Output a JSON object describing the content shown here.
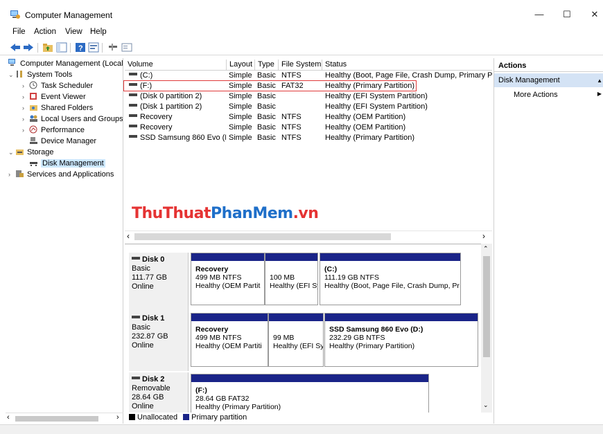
{
  "window": {
    "title": "Computer Management",
    "minimize_glyph": "—",
    "maximize_glyph": "☐",
    "close_glyph": "✕"
  },
  "menu": [
    "File",
    "Action",
    "View",
    "Help"
  ],
  "toolbar": {
    "icons": [
      "back-arrow-icon",
      "forward-arrow-icon",
      "up-folder-icon",
      "show-hide-tree-icon",
      "help-icon",
      "properties-icon",
      "connect-icon",
      "view-icon"
    ]
  },
  "tree": {
    "root": "Computer Management (Local",
    "system_tools": "System Tools",
    "task_scheduler": "Task Scheduler",
    "event_viewer": "Event Viewer",
    "shared_folders": "Shared Folders",
    "local_users": "Local Users and Groups",
    "performance": "Performance",
    "device_manager": "Device Manager",
    "storage": "Storage",
    "disk_management": "Disk Management",
    "services": "Services and Applications"
  },
  "volumes": {
    "headers": [
      "Volume",
      "Layout",
      "Type",
      "File System",
      "Status"
    ],
    "rows": [
      [
        "(C:)",
        "Simple",
        "Basic",
        "NTFS",
        "Healthy (Boot, Page File, Crash Dump, Primary Part"
      ],
      [
        "(F:)",
        "Simple",
        "Basic",
        "FAT32",
        "Healthy (Primary Partition)"
      ],
      [
        "(Disk 0 partition 2)",
        "Simple",
        "Basic",
        "",
        "Healthy (EFI System Partition)"
      ],
      [
        "(Disk 1 partition 2)",
        "Simple",
        "Basic",
        "",
        "Healthy (EFI System Partition)"
      ],
      [
        "Recovery",
        "Simple",
        "Basic",
        "NTFS",
        "Healthy (OEM Partition)"
      ],
      [
        "Recovery",
        "Simple",
        "Basic",
        "NTFS",
        "Healthy (OEM Partition)"
      ],
      [
        "SSD Samsung 860 Evo (D:)",
        "Simple",
        "Basic",
        "NTFS",
        "Healthy (Primary Partition)"
      ]
    ]
  },
  "watermark": {
    "part1": "ThuThuat",
    "part2": "PhanMem",
    "part3": ".vn"
  },
  "disks": [
    {
      "name": "Disk 0",
      "type": "Basic",
      "size": "111.77 GB",
      "status": "Online",
      "partitions": [
        {
          "name": "Recovery",
          "size": "499 MB NTFS",
          "status": "Healthy (OEM Partit"
        },
        {
          "name": "",
          "size": "100 MB",
          "status": "Healthy (EFI Sy"
        },
        {
          "name": "(C:)",
          "size": "111.19 GB NTFS",
          "status": "Healthy (Boot, Page File, Crash Dump, Pr"
        }
      ]
    },
    {
      "name": "Disk 1",
      "type": "Basic",
      "size": "232.87 GB",
      "status": "Online",
      "partitions": [
        {
          "name": "Recovery",
          "size": "499 MB NTFS",
          "status": "Healthy (OEM Partiti"
        },
        {
          "name": "",
          "size": "99 MB",
          "status": "Healthy (EFI Sy"
        },
        {
          "name": "SSD Samsung 860 Evo  (D:)",
          "size": "232.29 GB NTFS",
          "status": "Healthy (Primary Partition)"
        }
      ]
    },
    {
      "name": "Disk 2",
      "type": "Removable",
      "size": "28.64 GB",
      "status": "Online",
      "partitions": [
        {
          "name": "(F:)",
          "size": "28.64 GB FAT32",
          "status": "Healthy (Primary Partition)"
        }
      ]
    }
  ],
  "legend": {
    "unallocated": "Unallocated",
    "primary": "Primary partition"
  },
  "colors": {
    "primary_partition": "#1a2488",
    "unallocated": "#000000",
    "selection": "#cce8ff",
    "actions_header": "#d4e3f5",
    "highlight_box": "#e03a3a"
  },
  "actions": {
    "header": "Actions",
    "section": "Disk Management",
    "more": "More Actions"
  }
}
